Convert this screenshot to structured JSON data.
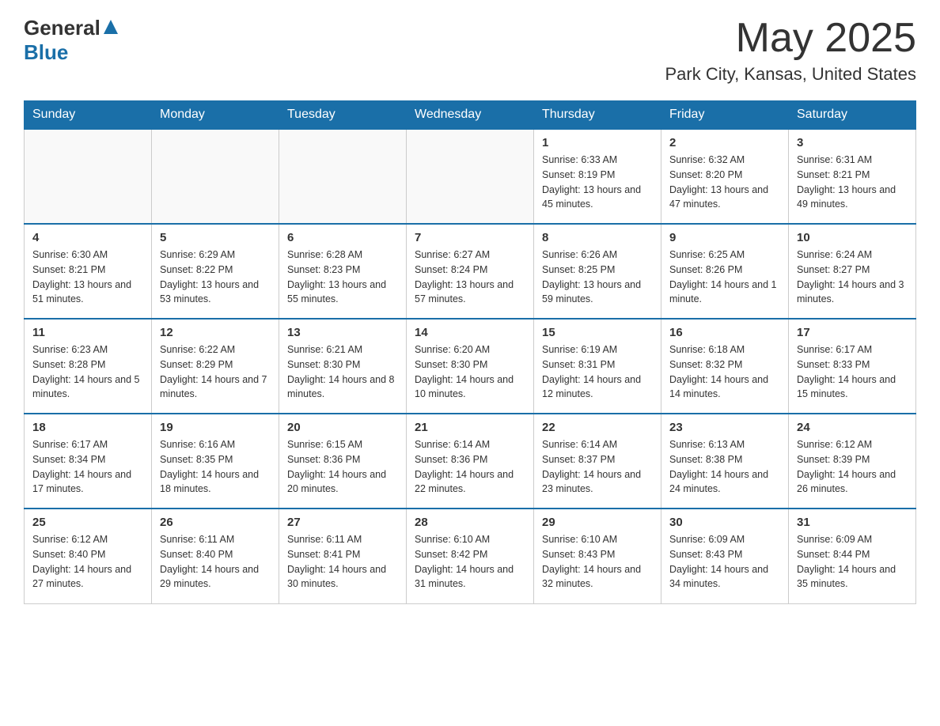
{
  "header": {
    "logo_general": "General",
    "logo_blue": "Blue",
    "month_year": "May 2025",
    "location": "Park City, Kansas, United States"
  },
  "days_of_week": [
    "Sunday",
    "Monday",
    "Tuesday",
    "Wednesday",
    "Thursday",
    "Friday",
    "Saturday"
  ],
  "weeks": [
    {
      "cells": [
        {
          "day": "",
          "info": ""
        },
        {
          "day": "",
          "info": ""
        },
        {
          "day": "",
          "info": ""
        },
        {
          "day": "",
          "info": ""
        },
        {
          "day": "1",
          "info": "Sunrise: 6:33 AM\nSunset: 8:19 PM\nDaylight: 13 hours and 45 minutes."
        },
        {
          "day": "2",
          "info": "Sunrise: 6:32 AM\nSunset: 8:20 PM\nDaylight: 13 hours and 47 minutes."
        },
        {
          "day": "3",
          "info": "Sunrise: 6:31 AM\nSunset: 8:21 PM\nDaylight: 13 hours and 49 minutes."
        }
      ]
    },
    {
      "cells": [
        {
          "day": "4",
          "info": "Sunrise: 6:30 AM\nSunset: 8:21 PM\nDaylight: 13 hours and 51 minutes."
        },
        {
          "day": "5",
          "info": "Sunrise: 6:29 AM\nSunset: 8:22 PM\nDaylight: 13 hours and 53 minutes."
        },
        {
          "day": "6",
          "info": "Sunrise: 6:28 AM\nSunset: 8:23 PM\nDaylight: 13 hours and 55 minutes."
        },
        {
          "day": "7",
          "info": "Sunrise: 6:27 AM\nSunset: 8:24 PM\nDaylight: 13 hours and 57 minutes."
        },
        {
          "day": "8",
          "info": "Sunrise: 6:26 AM\nSunset: 8:25 PM\nDaylight: 13 hours and 59 minutes."
        },
        {
          "day": "9",
          "info": "Sunrise: 6:25 AM\nSunset: 8:26 PM\nDaylight: 14 hours and 1 minute."
        },
        {
          "day": "10",
          "info": "Sunrise: 6:24 AM\nSunset: 8:27 PM\nDaylight: 14 hours and 3 minutes."
        }
      ]
    },
    {
      "cells": [
        {
          "day": "11",
          "info": "Sunrise: 6:23 AM\nSunset: 8:28 PM\nDaylight: 14 hours and 5 minutes."
        },
        {
          "day": "12",
          "info": "Sunrise: 6:22 AM\nSunset: 8:29 PM\nDaylight: 14 hours and 7 minutes."
        },
        {
          "day": "13",
          "info": "Sunrise: 6:21 AM\nSunset: 8:30 PM\nDaylight: 14 hours and 8 minutes."
        },
        {
          "day": "14",
          "info": "Sunrise: 6:20 AM\nSunset: 8:30 PM\nDaylight: 14 hours and 10 minutes."
        },
        {
          "day": "15",
          "info": "Sunrise: 6:19 AM\nSunset: 8:31 PM\nDaylight: 14 hours and 12 minutes."
        },
        {
          "day": "16",
          "info": "Sunrise: 6:18 AM\nSunset: 8:32 PM\nDaylight: 14 hours and 14 minutes."
        },
        {
          "day": "17",
          "info": "Sunrise: 6:17 AM\nSunset: 8:33 PM\nDaylight: 14 hours and 15 minutes."
        }
      ]
    },
    {
      "cells": [
        {
          "day": "18",
          "info": "Sunrise: 6:17 AM\nSunset: 8:34 PM\nDaylight: 14 hours and 17 minutes."
        },
        {
          "day": "19",
          "info": "Sunrise: 6:16 AM\nSunset: 8:35 PM\nDaylight: 14 hours and 18 minutes."
        },
        {
          "day": "20",
          "info": "Sunrise: 6:15 AM\nSunset: 8:36 PM\nDaylight: 14 hours and 20 minutes."
        },
        {
          "day": "21",
          "info": "Sunrise: 6:14 AM\nSunset: 8:36 PM\nDaylight: 14 hours and 22 minutes."
        },
        {
          "day": "22",
          "info": "Sunrise: 6:14 AM\nSunset: 8:37 PM\nDaylight: 14 hours and 23 minutes."
        },
        {
          "day": "23",
          "info": "Sunrise: 6:13 AM\nSunset: 8:38 PM\nDaylight: 14 hours and 24 minutes."
        },
        {
          "day": "24",
          "info": "Sunrise: 6:12 AM\nSunset: 8:39 PM\nDaylight: 14 hours and 26 minutes."
        }
      ]
    },
    {
      "cells": [
        {
          "day": "25",
          "info": "Sunrise: 6:12 AM\nSunset: 8:40 PM\nDaylight: 14 hours and 27 minutes."
        },
        {
          "day": "26",
          "info": "Sunrise: 6:11 AM\nSunset: 8:40 PM\nDaylight: 14 hours and 29 minutes."
        },
        {
          "day": "27",
          "info": "Sunrise: 6:11 AM\nSunset: 8:41 PM\nDaylight: 14 hours and 30 minutes."
        },
        {
          "day": "28",
          "info": "Sunrise: 6:10 AM\nSunset: 8:42 PM\nDaylight: 14 hours and 31 minutes."
        },
        {
          "day": "29",
          "info": "Sunrise: 6:10 AM\nSunset: 8:43 PM\nDaylight: 14 hours and 32 minutes."
        },
        {
          "day": "30",
          "info": "Sunrise: 6:09 AM\nSunset: 8:43 PM\nDaylight: 14 hours and 34 minutes."
        },
        {
          "day": "31",
          "info": "Sunrise: 6:09 AM\nSunset: 8:44 PM\nDaylight: 14 hours and 35 minutes."
        }
      ]
    }
  ]
}
